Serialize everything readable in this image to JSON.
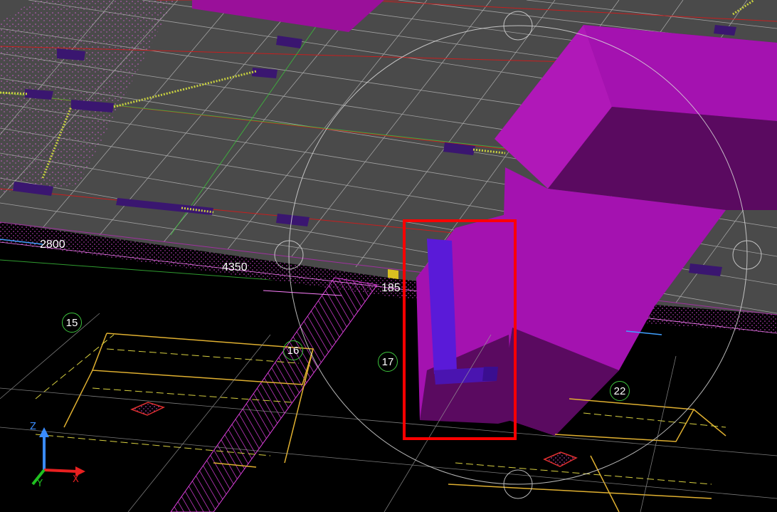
{
  "viewport": {
    "dimensions": [
      "2800",
      "4350",
      "185"
    ],
    "grid_bubbles": [
      "15",
      "16",
      "17",
      "22"
    ],
    "ucs": {
      "z": "Z",
      "x": "X",
      "y": "Y"
    },
    "selection_box_color": "#ff0000",
    "colors": {
      "floor": "#4a4a4a",
      "slab_edge": "#c23cc2",
      "solid_magenta": "#a412b0",
      "solid_dark": "#5a0a60",
      "solid_blue": "#5a1ad8",
      "column_pad": "#3a1670",
      "grid_line_red": "#c81e1e",
      "grid_bubble": "#3cc33c",
      "dim_yellow": "#e0b030"
    }
  }
}
